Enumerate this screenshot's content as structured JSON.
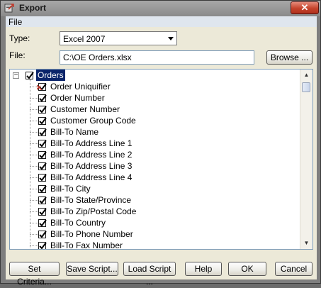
{
  "window": {
    "title": "Export",
    "close_glyph": "✕",
    "icon": "export-app-icon"
  },
  "menu": {
    "file": "File"
  },
  "form": {
    "type_label": "Type:",
    "type_value": "Excel 2007",
    "file_label": "File:",
    "file_value": "C:\\OE Orders.xlsx",
    "browse_label": "Browse ..."
  },
  "tree": {
    "root": {
      "label": "Orders",
      "checked": true,
      "expanded": true
    },
    "items": [
      {
        "label": "Order Uniquifier",
        "checked": true,
        "key": true
      },
      {
        "label": "Order Number",
        "checked": true
      },
      {
        "label": "Customer Number",
        "checked": true
      },
      {
        "label": "Customer Group Code",
        "checked": true
      },
      {
        "label": "Bill-To Name",
        "checked": true
      },
      {
        "label": "Bill-To Address Line 1",
        "checked": true
      },
      {
        "label": "Bill-To Address Line 2",
        "checked": true
      },
      {
        "label": "Bill-To Address Line 3",
        "checked": true
      },
      {
        "label": "Bill-To Address Line 4",
        "checked": true
      },
      {
        "label": "Bill-To City",
        "checked": true
      },
      {
        "label": "Bill-To State/Province",
        "checked": true
      },
      {
        "label": "Bill-To Zip/Postal Code",
        "checked": true
      },
      {
        "label": "Bill-To Country",
        "checked": true
      },
      {
        "label": "Bill-To Phone Number",
        "checked": true
      },
      {
        "label": "Bill-To Fax Number",
        "checked": true
      }
    ]
  },
  "buttons": {
    "set_criteria": "Set Criteria...",
    "save_script": "Save Script...",
    "load_script": "Load Script ...",
    "help": "Help",
    "ok": "OK",
    "cancel": "Cancel"
  }
}
